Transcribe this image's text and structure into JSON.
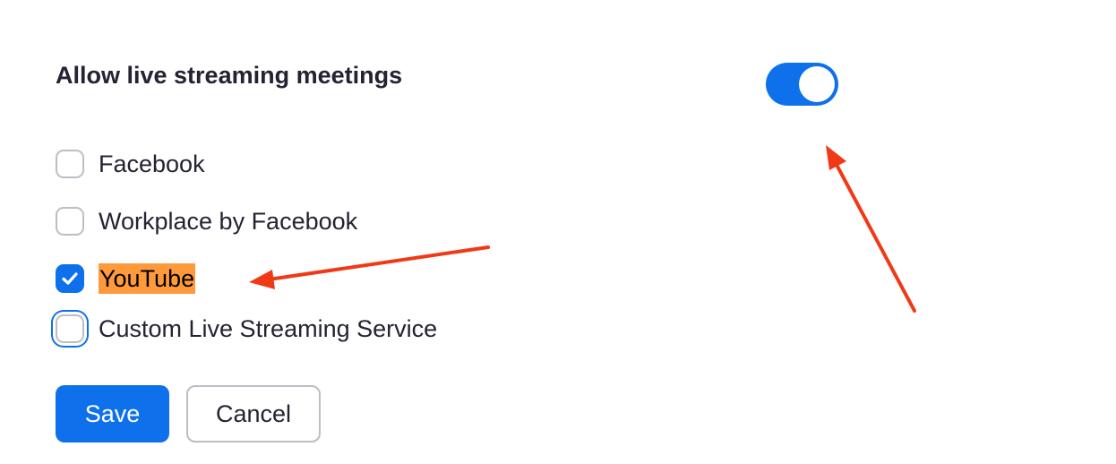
{
  "setting": {
    "title": "Allow live streaming meetings",
    "toggle_on": true
  },
  "options": [
    {
      "label": "Facebook",
      "checked": false
    },
    {
      "label": "Workplace by Facebook",
      "checked": false
    },
    {
      "label": "YouTube",
      "checked": true,
      "highlighted": true
    },
    {
      "label": "Custom Live Streaming Service",
      "checked": false,
      "focused": true
    }
  ],
  "buttons": {
    "save_label": "Save",
    "cancel_label": "Cancel"
  },
  "icons": {
    "checkbox_check": "check-icon"
  },
  "colors": {
    "accent": "#0e71eb",
    "text": "#232333",
    "border": "#bdbdc6",
    "highlight": "#ff9a3c",
    "annotation_arrow": "#f03a17"
  }
}
